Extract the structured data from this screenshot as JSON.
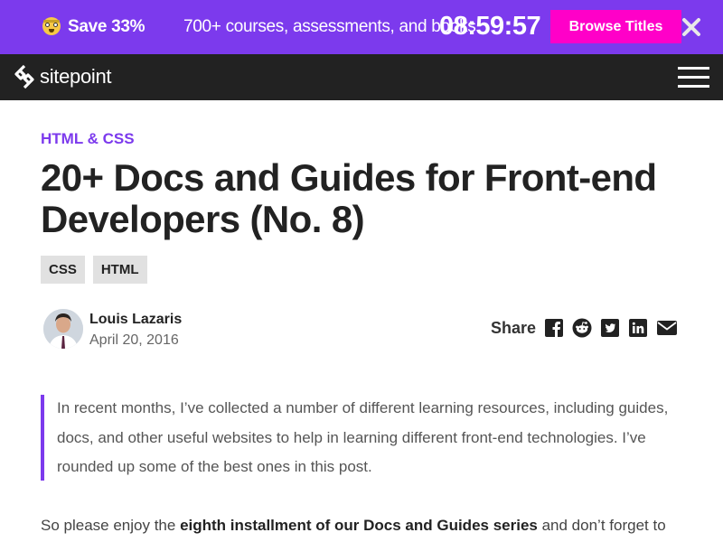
{
  "promo": {
    "emoji_icon": "shocked-face-icon",
    "save_text": "Save 33%",
    "text": "700+ courses, assessments, and books",
    "timer": "08:59:57",
    "button_label": "Browse Titles",
    "close_icon": "close-icon",
    "bg_color": "#7c3aed",
    "button_color": "#ff00c8"
  },
  "nav": {
    "logo_text": "sitepoint",
    "menu_icon": "hamburger-menu-icon"
  },
  "article": {
    "category": "HTML & CSS",
    "title": "20+ Docs and Guides for Front-end Developers (No. 8)",
    "tags": [
      "CSS",
      "HTML"
    ],
    "author": {
      "name": "Louis Lazaris",
      "date": "April 20, 2016"
    },
    "share": {
      "label": "Share",
      "icons": [
        "facebook-icon",
        "reddit-icon",
        "twitter-icon",
        "linkedin-icon",
        "email-icon"
      ]
    },
    "intro": "In recent months, I’ve collected a number of different learning resources, including guides, docs, and other useful websites to help in learning different front-end technologies. I’ve rounded up some of the best ones in this post.",
    "body_start": "So please enjoy the ",
    "body_bold": "eighth installment of our Docs and Guides series",
    "body_end": " and don’t forget to"
  },
  "colors": {
    "accent": "#7c3aed",
    "nav_bg": "#222222",
    "tag_bg": "#e1e1e1"
  }
}
